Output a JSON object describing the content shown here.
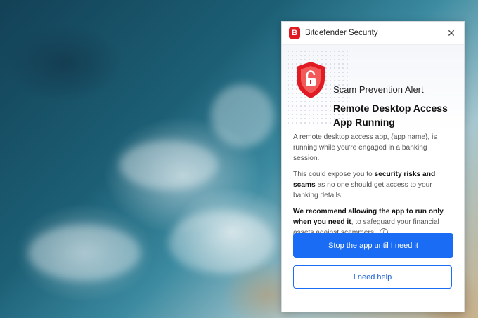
{
  "app": {
    "title": "Bitdefender Security",
    "logo_letter": "B",
    "brand_color": "#e01b24",
    "close_icon": "close-icon",
    "close_glyph": "✕"
  },
  "alert": {
    "kicker": "Scam Prevention Alert",
    "title": "Remote Desktop Access App Running",
    "icon": "shield-lock-icon"
  },
  "body": {
    "p1": "A remote desktop access app, {app name}, is running while you're engaged in a banking session.",
    "p2_prefix": "This could expose you to ",
    "p2_strong": "security risks and scams",
    "p2_suffix": " as no one should get access to your banking details.",
    "p3_strong": "We recommend allowing the app to run only when you need it",
    "p3_suffix": ", to safeguard your financial assets against scammers.",
    "info_glyph": "i"
  },
  "buttons": {
    "primary": "Stop the app until I need it",
    "secondary": "I need help",
    "primary_color": "#1a6cf5"
  }
}
